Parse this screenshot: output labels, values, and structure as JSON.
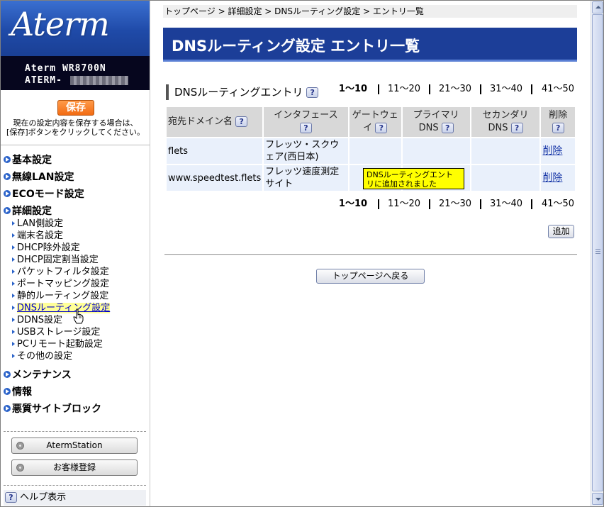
{
  "sidebar": {
    "logo": "Aterm",
    "model_name": "Aterm WR8700N",
    "model_id": "ATERM-",
    "save_label": "保存",
    "save_note_line1": "現在の設定内容を保存する場合は、",
    "save_note_line2": "[保存]ボタンをクリックしてください。",
    "categories": {
      "basic": "基本設定",
      "wireless": "無線LAN設定",
      "eco": "ECOモード設定",
      "advanced": "詳細設定",
      "maintenance": "メンテナンス",
      "info": "情報",
      "block": "悪質サイトブロック"
    },
    "advanced_items": [
      "LAN側設定",
      "端末名設定",
      "DHCP除外設定",
      "DHCP固定割当設定",
      "パケットフィルタ設定",
      "ポートマッピング設定",
      "静的ルーティング設定",
      "DNSルーティング設定",
      "DDNS設定",
      "USBストレージ設定",
      "PCリモート起動設定",
      "その他の設定"
    ],
    "aterm_station_label": "AtermStation",
    "customer_reg_label": "お客様登録",
    "help_label": "ヘルプ表示"
  },
  "breadcrumb": "トップページ > 詳細設定 > DNSルーティング設定 > エントリ一覧",
  "page_title": "DNSルーティング設定 エントリ一覧",
  "section_title": "DNSルーティングエントリ",
  "help_glyph": "?",
  "pager": [
    "1〜10",
    "11〜20",
    "21〜30",
    "31〜40",
    "41〜50"
  ],
  "table": {
    "headers": {
      "domain": "宛先ドメイン名",
      "interface": "インタフェース",
      "gateway": "ゲートウェイ",
      "primary_dns": "プライマリDNS",
      "secondary_dns": "セカンダリDNS",
      "delete": "削除"
    },
    "rows": [
      {
        "domain": "flets",
        "interface": "フレッツ・スクウェア(西日本)",
        "gateway": "",
        "primary_dns": "",
        "secondary_dns": "",
        "delete": "削除"
      },
      {
        "domain": "www.speedtest.flets",
        "interface": "フレッツ速度測定サイト",
        "gateway": "",
        "primary_dns": "",
        "secondary_dns": "",
        "delete": "削除"
      }
    ]
  },
  "notice": "DNSルーティングエントリに追加されました",
  "add_label": "追加",
  "top_page_label": "トップページへ戻る",
  "colors": {
    "title_bar": "#1c3e98",
    "save_button": "#f26b13",
    "active_item_bg": "#ffff99",
    "notice_bg": "#ffff00"
  }
}
